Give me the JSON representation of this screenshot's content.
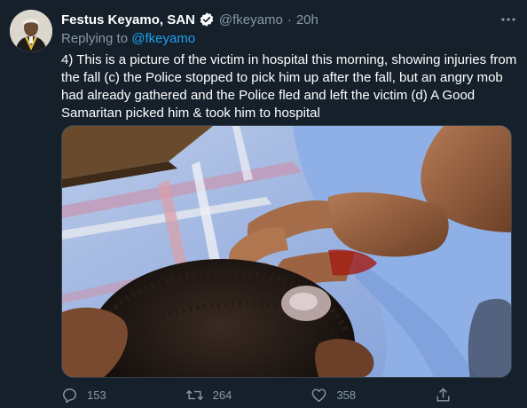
{
  "tweet": {
    "author": {
      "display_name": "Festus Keyamo, SAN",
      "handle": "@fkeyamo",
      "verified": true,
      "avatar": "profile-photo"
    },
    "separator": "·",
    "timestamp": "20h",
    "replying_to": {
      "prefix": "Replying to",
      "mention": "@fkeyamo"
    },
    "text": "4) This is a picture of the victim in hospital this morning, showing  injuries from the fall (c) the Police stopped to pick him up after the fall, but an angry mob had already gathered and the Police fled and left the victim (d) A Good Samaritan picked him & took him to hospital",
    "media": {
      "type": "photo",
      "subject": "head-injury-photo"
    },
    "actions": {
      "reply": {
        "icon": "reply-icon",
        "count": "153"
      },
      "retweet": {
        "icon": "retweet-icon",
        "count": "264"
      },
      "like": {
        "icon": "heart-icon",
        "count": "358"
      },
      "share": {
        "icon": "share-icon"
      }
    }
  },
  "colors": {
    "background": "#15202b",
    "text": "#ffffff",
    "secondary": "#8899a6",
    "accent": "#1da1f2"
  }
}
